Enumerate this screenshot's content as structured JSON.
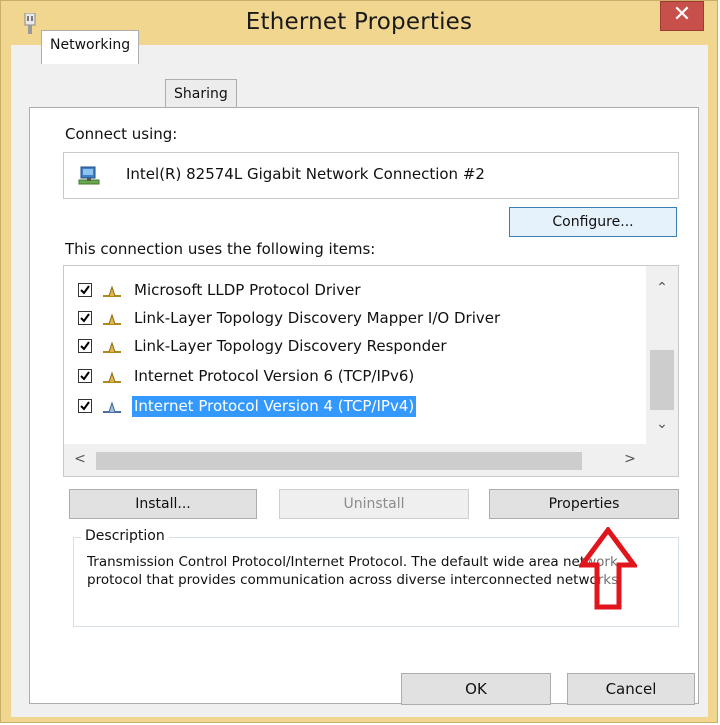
{
  "window": {
    "title": "Ethernet Properties",
    "close_glyph": "✕"
  },
  "tabs": [
    {
      "label": "Networking",
      "active": true
    },
    {
      "label": "Sharing",
      "active": false
    }
  ],
  "networking": {
    "connect_using_label": "Connect using:",
    "adapter_name": "Intel(R) 82574L Gigabit Network Connection #2",
    "configure_button": "Configure...",
    "items_label": "This connection uses the following items:",
    "items": [
      {
        "label": "Microsoft LLDP Protocol Driver",
        "checked": true,
        "selected": false
      },
      {
        "label": "Link-Layer Topology Discovery Mapper I/O Driver",
        "checked": true,
        "selected": false
      },
      {
        "label": "Link-Layer Topology Discovery Responder",
        "checked": true,
        "selected": false
      },
      {
        "label": "Internet Protocol Version 6 (TCP/IPv6)",
        "checked": true,
        "selected": false
      },
      {
        "label": "Internet Protocol Version 4 (TCP/IPv4)",
        "checked": true,
        "selected": true
      }
    ],
    "install_button": "Install...",
    "uninstall_button": "Uninstall",
    "properties_button": "Properties",
    "description_title": "Description",
    "description_text": "Transmission Control Protocol/Internet Protocol. The default wide area network protocol that provides communication across diverse interconnected networks."
  },
  "footer": {
    "ok_button": "OK",
    "cancel_button": "Cancel"
  },
  "annotation": {
    "arrow_color": "#e0161c",
    "icon": "up-arrow-icon"
  },
  "colors": {
    "title_bar": "#f1d690",
    "close_button": "#c7514a",
    "selection": "#3399ff"
  }
}
